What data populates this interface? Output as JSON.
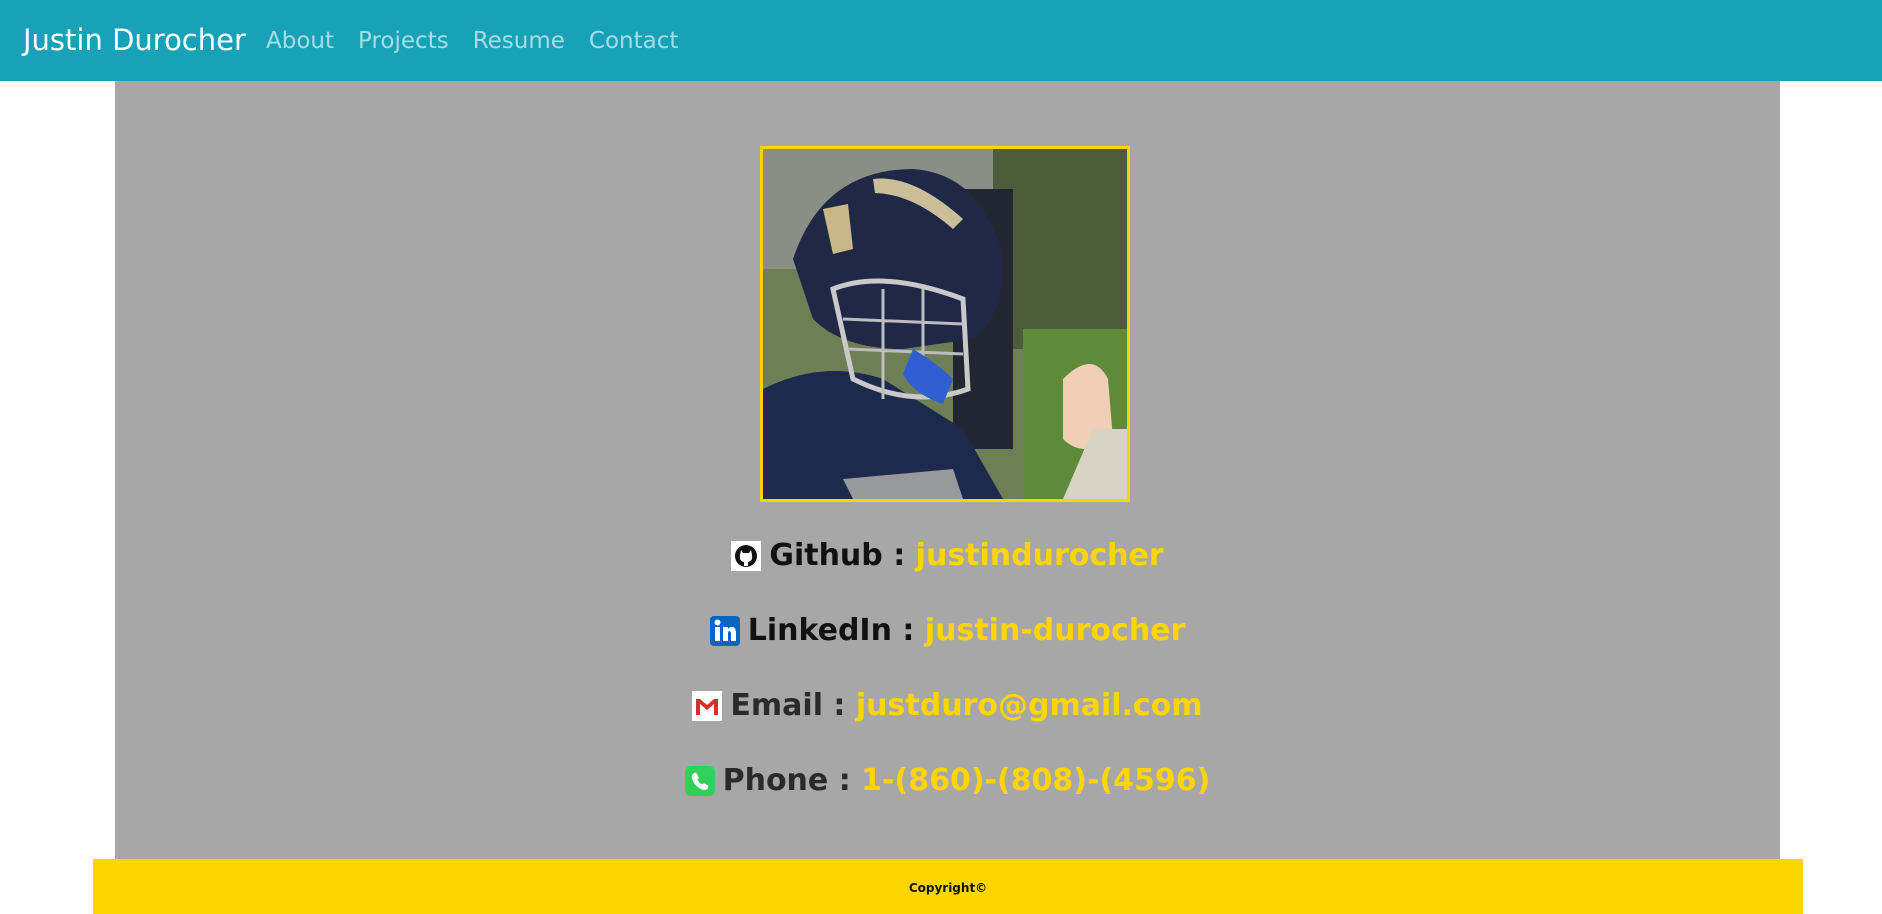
{
  "nav": {
    "brand": "Justin Durocher",
    "links": [
      "About",
      "Projects",
      "Resume",
      "Contact"
    ]
  },
  "profile_photo": {
    "icon": "profile-photo"
  },
  "contacts": [
    {
      "label": "Github :",
      "value": "justindurocher",
      "icon": "github-icon"
    },
    {
      "label": "LinkedIn :",
      "value": "justin-durocher",
      "icon": "linkedin-icon"
    },
    {
      "label": "Email :",
      "value": "justduro@gmail.com",
      "icon": "gmail-icon"
    },
    {
      "label": "Phone :",
      "value": "1-(860)-(808)-(4596)",
      "icon": "phone-icon"
    }
  ],
  "footer": {
    "text": "Copyright©"
  },
  "colors": {
    "navbar": "#17a2b8",
    "panel": "#a7a7a7",
    "accent": "#ffd500"
  }
}
